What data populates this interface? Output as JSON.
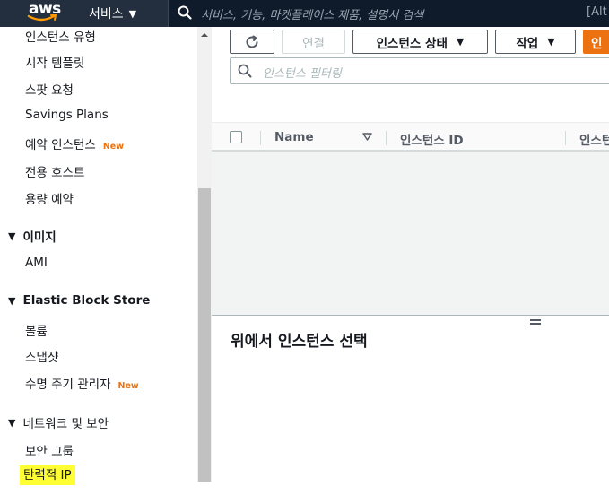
{
  "topbar": {
    "logo": "aws",
    "services_label": "서비스",
    "search_placeholder": "서비스, 기능, 마켓플레이스 제품, 설명서 검색",
    "search_hint": "[Alt"
  },
  "sidebar": {
    "items_top": [
      {
        "label": "인스턴스 유형",
        "badge": ""
      },
      {
        "label": "시작 템플릿",
        "badge": ""
      },
      {
        "label": "스팟 요청",
        "badge": ""
      },
      {
        "label": "Savings Plans",
        "badge": ""
      },
      {
        "label": "예약 인스턴스",
        "badge": "New"
      },
      {
        "label": "전용 호스트",
        "badge": ""
      },
      {
        "label": "용량 예약",
        "badge": ""
      }
    ],
    "section_images": "이미지",
    "images_items": [
      {
        "label": "AMI"
      }
    ],
    "section_ebs": "Elastic Block Store",
    "ebs_items": [
      {
        "label": "볼륨",
        "badge": ""
      },
      {
        "label": "스냅샷",
        "badge": ""
      },
      {
        "label": "수명 주기 관리자",
        "badge": "New"
      }
    ],
    "section_network": "네트워크 및 보안",
    "network_items": [
      {
        "label": "보안 그룹"
      },
      {
        "label": "탄력적 IP"
      }
    ]
  },
  "toolbar": {
    "connect_label": "연결",
    "instance_state_label": "인스턴스 상태",
    "actions_label": "작업",
    "launch_label": "인"
  },
  "filter": {
    "placeholder": "인스턴스 필터링"
  },
  "table": {
    "columns": [
      "Name",
      "인스턴스 ID",
      "인스턴"
    ]
  },
  "detail": {
    "title": "위에서 인스턴스 선택"
  },
  "colors": {
    "nav_bg": "#232f3e",
    "accent": "#ec7211",
    "highlight": "#ffff33"
  }
}
